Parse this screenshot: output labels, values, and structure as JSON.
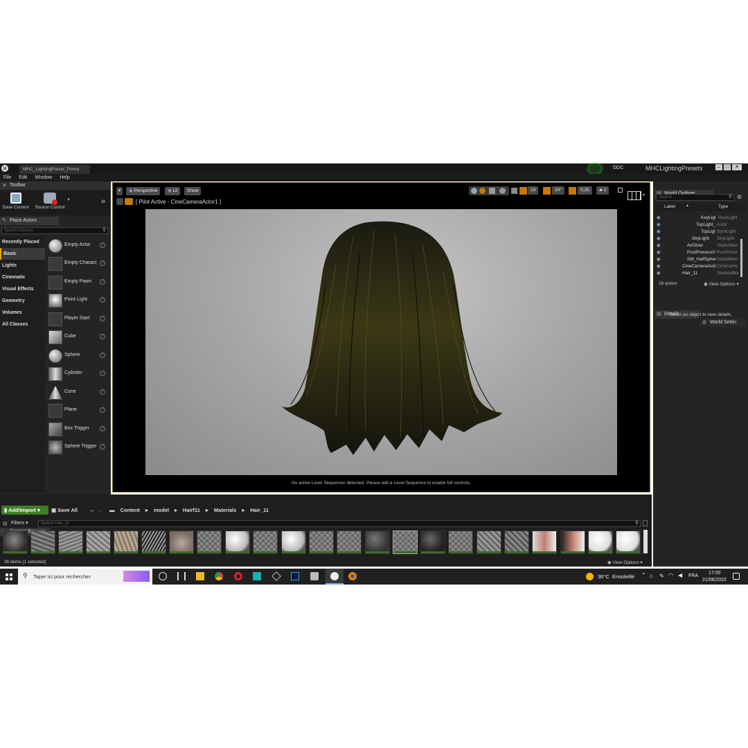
{
  "window": {
    "tab_title": "MHC_LightingPreset_Portra",
    "project_name": "MHCLightingPresets",
    "ddc_label": "DDC"
  },
  "menu": [
    "File",
    "Edit",
    "Window",
    "Help"
  ],
  "toolbar": {
    "title": "Toolbar",
    "save_current": "Save Current",
    "source_control": "Source Control"
  },
  "place_actors": {
    "title": "Place Actors",
    "search_placeholder": "Search Classes",
    "categories": [
      "Recently Placed",
      "Basic",
      "Lights",
      "Cinematic",
      "Visual Effects",
      "Geometry",
      "Volumes",
      "All Classes"
    ],
    "selected_category": "Basic",
    "items": [
      "Empty Actor",
      "Empty Charact",
      "Empty Pawn",
      "Point Light",
      "Player Start",
      "Cube",
      "Sphere",
      "Cylinder",
      "Cone",
      "Plane",
      "Box Trigger",
      "Sphere Trigger"
    ]
  },
  "viewport": {
    "perspective": "Perspective",
    "lit": "Lit",
    "show": "Show",
    "pilot": "[ Pilot Active - CineCameraActor1 ]",
    "grid_snap": "10",
    "rot_snap": "10°",
    "scale_snap": "0,25",
    "cam_speed": "2",
    "sequencer_msg": "No active Level Sequencer detected. Please edit a Level Sequence to enable full controls."
  },
  "outliner": {
    "title": "World Outliner",
    "search_placeholder": "Search...",
    "col_label": "Label",
    "col_type": "Type",
    "rows": [
      {
        "label": "KeyLigl",
        "type": "RectLight"
      },
      {
        "label": "TopLight_",
        "type": "Actor"
      },
      {
        "label": "TopLigl",
        "type": "SpotLight"
      },
      {
        "label": "SkyLight",
        "type": "SkyLight"
      },
      {
        "label": "AirGlow",
        "type": "StaticMesl"
      },
      {
        "label": "PostProcessV",
        "type": "PostProce"
      },
      {
        "label": "SM_HalfSpher",
        "type": "StaticMesl"
      },
      {
        "label": "CineCameraActc",
        "type": "CineCame"
      },
      {
        "label": "Hair_11",
        "type": "SkeletalMe"
      }
    ],
    "count": "16 actors",
    "view_options": "View Options"
  },
  "details": {
    "tab_details": "Details",
    "tab_world": "World Settin",
    "empty_msg": "Select an object to view details."
  },
  "content_browser": {
    "title": "Content Browser",
    "add_import": "Add/Import",
    "save_all": "Save All",
    "path": [
      "Content",
      "model",
      "Hairf11",
      "Materials",
      "Hair_11"
    ],
    "filters": "Filters",
    "search_placeholder": "Search Hair_11",
    "status": "36 items (1 selected)",
    "view_options": "View Options"
  },
  "taskbar": {
    "search_placeholder": "Taper ici pour rechercher",
    "weather": "36°C  Ensoleillé",
    "lang": "FRA",
    "time": "17:00",
    "date": "21/06/2022"
  },
  "colors": {
    "accent": "#e8a000",
    "add_button": "#3f7e26",
    "panel_bg": "#242424"
  }
}
